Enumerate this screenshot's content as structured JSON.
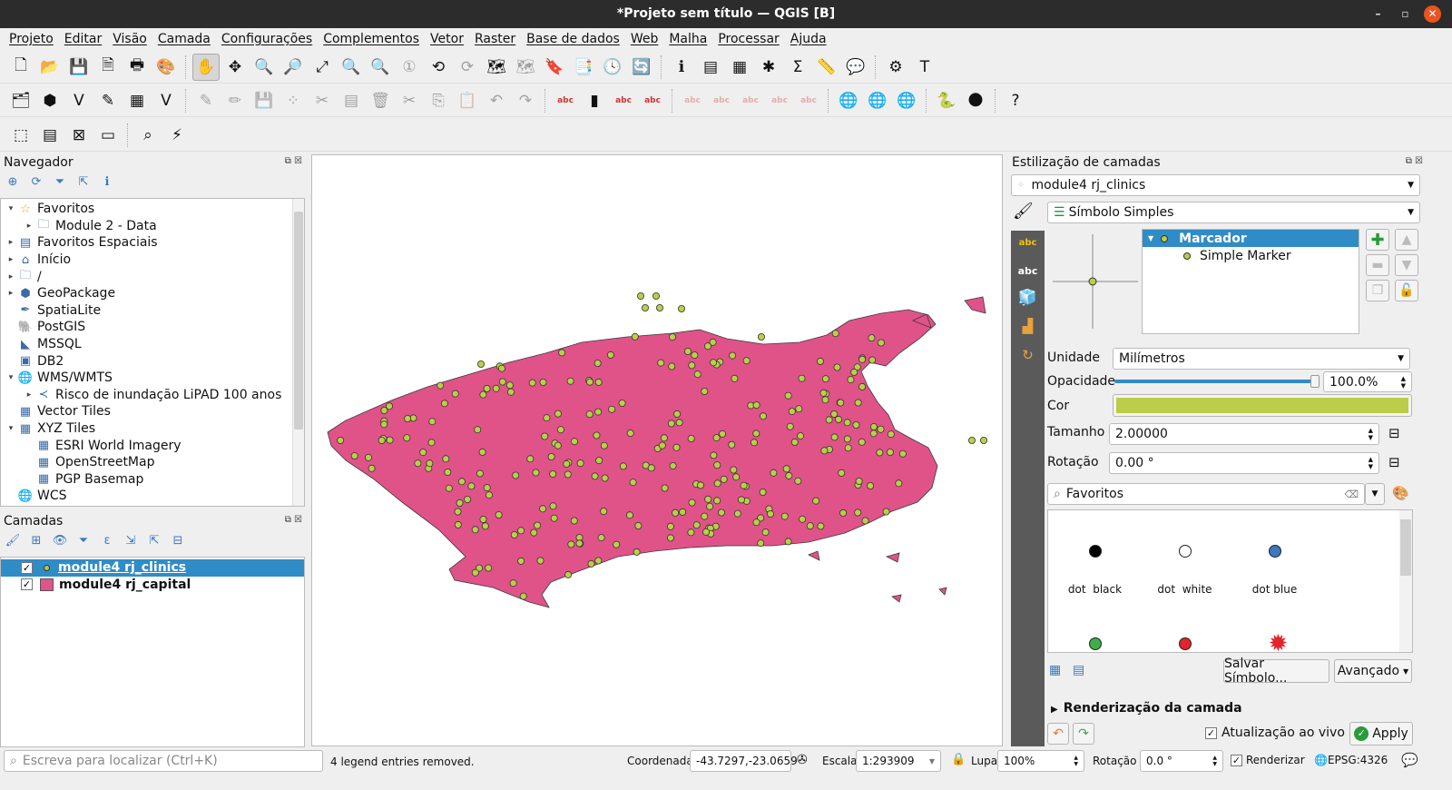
{
  "window": {
    "title": "*Projeto sem título — QGIS [B]",
    "minimize": "–",
    "maximize": "▫",
    "close": "✕"
  },
  "menu": [
    "Projeto",
    "Editar",
    "Visão",
    "Camada",
    "Configurações",
    "Complementos",
    "Vetor",
    "Raster",
    "Base de dados",
    "Web",
    "Malha",
    "Processar",
    "Ajuda"
  ],
  "toolbar1": [
    [
      "new-project",
      "🗋"
    ],
    [
      "open-project",
      "📂"
    ],
    [
      "save-project",
      "💾"
    ],
    [
      "save-as",
      "🗎"
    ],
    [
      "print-layout",
      "🖶"
    ],
    [
      "style-manager",
      "🎨"
    ],
    [
      "sep",
      ""
    ],
    [
      "pan",
      "✋"
    ],
    [
      "pan-to-selection",
      "✥"
    ],
    [
      "zoom-in",
      "🔍"
    ],
    [
      "zoom-out",
      "🔎"
    ],
    [
      "zoom-full",
      "⤢"
    ],
    [
      "zoom-selection",
      "🔍"
    ],
    [
      "zoom-layer",
      "🔍"
    ],
    [
      "zoom-native",
      "①"
    ],
    [
      "zoom-last",
      "⟲"
    ],
    [
      "zoom-next",
      "⟳"
    ],
    [
      "new-map-view",
      "🗺"
    ],
    [
      "new-3d-view",
      "🗺"
    ],
    [
      "spatial-bookmark",
      "🔖"
    ],
    [
      "show-bookmarks",
      "📑"
    ],
    [
      "temporal",
      "🕓"
    ],
    [
      "refresh",
      "🔄"
    ],
    [
      "sep",
      ""
    ],
    [
      "identify",
      "ℹ"
    ],
    [
      "attribute-table",
      "▤"
    ],
    [
      "field-calculator",
      "▦"
    ],
    [
      "settings",
      "✱"
    ],
    [
      "statistics",
      "Σ"
    ],
    [
      "measure",
      "📏"
    ],
    [
      "map-tips",
      "💬"
    ],
    [
      "sep",
      ""
    ],
    [
      "toolbox",
      "⚙"
    ],
    [
      "text-annotation",
      "T"
    ]
  ],
  "toolbar2": [
    [
      "data-source-manager",
      "🗂"
    ],
    [
      "add-vector",
      "⬢"
    ],
    [
      "new-shapefile",
      "V"
    ],
    [
      "digitize",
      "✎"
    ],
    [
      "add-wms",
      "▦"
    ],
    [
      "virtual-layer",
      "V"
    ],
    [
      "sep",
      ""
    ],
    [
      "edits",
      "✎"
    ],
    [
      "toggle-edit",
      "✏"
    ],
    [
      "save-edits",
      "💾"
    ],
    [
      "add-feature",
      "⁘"
    ],
    [
      "vertex-tool",
      "✂"
    ],
    [
      "modify-attributes",
      "▤"
    ],
    [
      "delete-selected",
      "🗑"
    ],
    [
      "cut",
      "✂"
    ],
    [
      "copy",
      "⎘"
    ],
    [
      "paste",
      "📋"
    ],
    [
      "undo",
      "↶"
    ],
    [
      "redo",
      "↷"
    ],
    [
      "sep",
      ""
    ],
    [
      "label-toolbar",
      "abc"
    ],
    [
      "diagram",
      "▮"
    ],
    [
      "highlight-label",
      "abc"
    ],
    [
      "label-pin",
      "abc"
    ],
    [
      "sep",
      ""
    ],
    [
      "show-hide-labels",
      "abc"
    ],
    [
      "move-label",
      "abc"
    ],
    [
      "rotate-label",
      "abc"
    ],
    [
      "change-label",
      "abc"
    ],
    [
      "label-props",
      "abc"
    ],
    [
      "sep",
      ""
    ],
    [
      "quickmapservices",
      "🌐"
    ],
    [
      "wms-search",
      "🌐"
    ],
    [
      "metasearch",
      "🌐"
    ],
    [
      "sep",
      ""
    ],
    [
      "python-console",
      "🐍"
    ],
    [
      "plugins-globe",
      "🌑"
    ],
    [
      "sep",
      ""
    ],
    [
      "help",
      "?"
    ]
  ],
  "toolbar3": [
    [
      "select-features",
      "⬚"
    ],
    [
      "select-by-value",
      "▤"
    ],
    [
      "deselect",
      "⊠"
    ],
    [
      "select-location",
      "▭"
    ],
    [
      "sep",
      ""
    ],
    [
      "locator",
      "⌕"
    ],
    [
      "processing",
      "⚡"
    ]
  ],
  "navigator": {
    "title": "Navegador",
    "tools": [
      [
        "add-selected",
        "⊕"
      ],
      [
        "refresh",
        "⟳"
      ],
      [
        "filter",
        "⏷"
      ],
      [
        "collapse",
        "⇱"
      ],
      [
        "info",
        "ℹ"
      ]
    ],
    "items": [
      {
        "label": "Favoritos",
        "icon": "star",
        "glyph": "☆",
        "arrow": "▾",
        "indent": 0
      },
      {
        "label": "Module 2 - Data",
        "icon": "folder",
        "glyph": "🗀",
        "arrow": "▸",
        "indent": 1
      },
      {
        "label": "Favoritos Espaciais",
        "icon": "bookmark",
        "glyph": "▤",
        "arrow": "▸",
        "indent": 0
      },
      {
        "label": "Início",
        "icon": "home",
        "glyph": "⌂",
        "arrow": "▸",
        "indent": 0
      },
      {
        "label": "/",
        "icon": "folder",
        "glyph": "🗀",
        "arrow": "▸",
        "indent": 0
      },
      {
        "label": "GeoPackage",
        "icon": "geopackage",
        "glyph": "⬢",
        "arrow": "▸",
        "indent": 0
      },
      {
        "label": "SpatiaLite",
        "icon": "spatialite",
        "glyph": "✒",
        "arrow": "",
        "indent": 0
      },
      {
        "label": "PostGIS",
        "icon": "postgis",
        "glyph": "🐘",
        "arrow": "",
        "indent": 0
      },
      {
        "label": "MSSQL",
        "icon": "mssql",
        "glyph": "◣",
        "arrow": "",
        "indent": 0
      },
      {
        "label": "DB2",
        "icon": "db2",
        "glyph": "▣",
        "arrow": "",
        "indent": 0
      },
      {
        "label": "WMS/WMTS",
        "icon": "globe",
        "glyph": "🌐",
        "arrow": "▾",
        "indent": 0
      },
      {
        "label": "Risco de inundação LiPAD 100 anos",
        "icon": "wms-layer",
        "glyph": "≺",
        "arrow": "▸",
        "indent": 1
      },
      {
        "label": "Vector Tiles",
        "icon": "vector-tiles",
        "glyph": "▦",
        "arrow": "",
        "indent": 0
      },
      {
        "label": "XYZ Tiles",
        "icon": "xyz-tiles",
        "glyph": "▦",
        "arrow": "▾",
        "indent": 0
      },
      {
        "label": "ESRI World Imagery",
        "icon": "tiles",
        "glyph": "▦",
        "arrow": "",
        "indent": 1
      },
      {
        "label": "OpenStreetMap",
        "icon": "tiles",
        "glyph": "▦",
        "arrow": "",
        "indent": 1
      },
      {
        "label": "PGP Basemap",
        "icon": "tiles",
        "glyph": "▦",
        "arrow": "",
        "indent": 1
      },
      {
        "label": "WCS",
        "icon": "globe",
        "glyph": "🌐",
        "arrow": "",
        "indent": 0
      }
    ]
  },
  "layers": {
    "title": "Camadas",
    "tools": [
      [
        "open-styling",
        "🖌"
      ],
      [
        "add-group",
        "⊞"
      ],
      [
        "visibility",
        "👁"
      ],
      [
        "filter",
        "⏷"
      ],
      [
        "expression-filter",
        "ε"
      ],
      [
        "expand",
        "⇲"
      ],
      [
        "collapse",
        "⇱"
      ],
      [
        "remove-layer",
        "⊟"
      ]
    ],
    "items": [
      {
        "label": "module4 rj_clinics",
        "checked": true,
        "selected": true,
        "color": "#b5c94a",
        "type": "point"
      },
      {
        "label": "module4 rj_capital",
        "checked": true,
        "selected": false,
        "color": "#e0548a",
        "type": "polygon"
      }
    ]
  },
  "map": {
    "fill": "#df5389",
    "stroke": "#3a3a3a",
    "point_fill": "#bccd4a"
  },
  "styling": {
    "title": "Estilização de camadas",
    "layer": "module4 rj_clinics",
    "renderer": "Símbolo Simples",
    "tree": {
      "parent": "Marcador",
      "child": "Simple Marker"
    },
    "unit_label": "Unidade",
    "unit": "Milímetros",
    "opacity_label": "Opacidade",
    "opacity": "100.0%",
    "opacity_value": 100,
    "color_label": "Cor",
    "color": "#bccd4a",
    "size_label": "Tamanho",
    "size": "2.00000",
    "rotation_label": "Rotação",
    "rotation": "0.00 °",
    "search": "Favoritos",
    "symbols": [
      {
        "label": "dot  black",
        "color": "#000"
      },
      {
        "label": "dot  white",
        "color": "#fff"
      },
      {
        "label": "dot blue",
        "color": "#3d77c0"
      },
      {
        "label": "",
        "color": "#3fae49"
      },
      {
        "label": "",
        "color": "#e3242b"
      },
      {
        "label": "",
        "color": "#e3242b"
      }
    ],
    "save_symbol": "Salvar Símbolo...",
    "advanced": "Avançado",
    "rendering": "Renderização da camada",
    "live_update": "Atualização ao vivo",
    "apply": "Apply"
  },
  "status": {
    "locator_placeholder": "Escreva para localizar (Ctrl+K)",
    "message": "4 legend entries removed.",
    "coord_label": "Coordenada",
    "coord": "-43.7297,-23.0659",
    "scale_label": "Escala",
    "scale": "1:293909",
    "magnifier_label": "Lupa",
    "magnifier": "100%",
    "rotation_label": "Rotação",
    "rotation": "0.0 °",
    "render_label": "Renderizar",
    "crs": "EPSG:4326"
  }
}
